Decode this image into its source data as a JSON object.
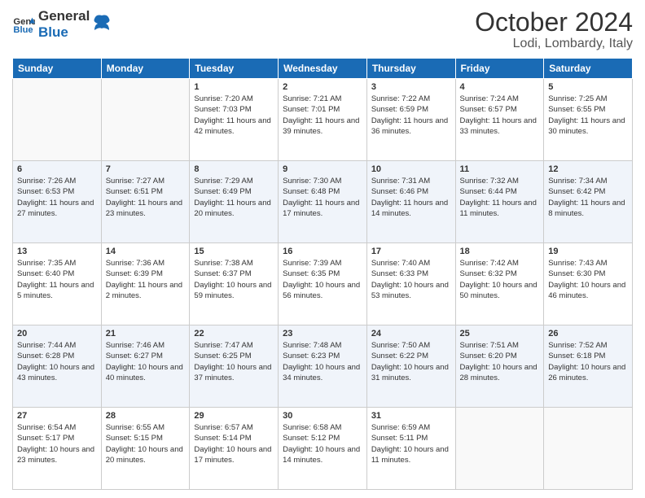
{
  "header": {
    "logo_general": "General",
    "logo_blue": "Blue",
    "month_title": "October 2024",
    "location": "Lodi, Lombardy, Italy"
  },
  "weekdays": [
    "Sunday",
    "Monday",
    "Tuesday",
    "Wednesday",
    "Thursday",
    "Friday",
    "Saturday"
  ],
  "weeks": [
    [
      {
        "day": "",
        "empty": true
      },
      {
        "day": "",
        "empty": true
      },
      {
        "day": "1",
        "sr": "7:20 AM",
        "ss": "7:03 PM",
        "dl": "11 hours and 42 minutes."
      },
      {
        "day": "2",
        "sr": "7:21 AM",
        "ss": "7:01 PM",
        "dl": "11 hours and 39 minutes."
      },
      {
        "day": "3",
        "sr": "7:22 AM",
        "ss": "6:59 PM",
        "dl": "11 hours and 36 minutes."
      },
      {
        "day": "4",
        "sr": "7:24 AM",
        "ss": "6:57 PM",
        "dl": "11 hours and 33 minutes."
      },
      {
        "day": "5",
        "sr": "7:25 AM",
        "ss": "6:55 PM",
        "dl": "11 hours and 30 minutes."
      }
    ],
    [
      {
        "day": "6",
        "sr": "7:26 AM",
        "ss": "6:53 PM",
        "dl": "11 hours and 27 minutes."
      },
      {
        "day": "7",
        "sr": "7:27 AM",
        "ss": "6:51 PM",
        "dl": "11 hours and 23 minutes."
      },
      {
        "day": "8",
        "sr": "7:29 AM",
        "ss": "6:49 PM",
        "dl": "11 hours and 20 minutes."
      },
      {
        "day": "9",
        "sr": "7:30 AM",
        "ss": "6:48 PM",
        "dl": "11 hours and 17 minutes."
      },
      {
        "day": "10",
        "sr": "7:31 AM",
        "ss": "6:46 PM",
        "dl": "11 hours and 14 minutes."
      },
      {
        "day": "11",
        "sr": "7:32 AM",
        "ss": "6:44 PM",
        "dl": "11 hours and 11 minutes."
      },
      {
        "day": "12",
        "sr": "7:34 AM",
        "ss": "6:42 PM",
        "dl": "11 hours and 8 minutes."
      }
    ],
    [
      {
        "day": "13",
        "sr": "7:35 AM",
        "ss": "6:40 PM",
        "dl": "11 hours and 5 minutes."
      },
      {
        "day": "14",
        "sr": "7:36 AM",
        "ss": "6:39 PM",
        "dl": "11 hours and 2 minutes."
      },
      {
        "day": "15",
        "sr": "7:38 AM",
        "ss": "6:37 PM",
        "dl": "10 hours and 59 minutes."
      },
      {
        "day": "16",
        "sr": "7:39 AM",
        "ss": "6:35 PM",
        "dl": "10 hours and 56 minutes."
      },
      {
        "day": "17",
        "sr": "7:40 AM",
        "ss": "6:33 PM",
        "dl": "10 hours and 53 minutes."
      },
      {
        "day": "18",
        "sr": "7:42 AM",
        "ss": "6:32 PM",
        "dl": "10 hours and 50 minutes."
      },
      {
        "day": "19",
        "sr": "7:43 AM",
        "ss": "6:30 PM",
        "dl": "10 hours and 46 minutes."
      }
    ],
    [
      {
        "day": "20",
        "sr": "7:44 AM",
        "ss": "6:28 PM",
        "dl": "10 hours and 43 minutes."
      },
      {
        "day": "21",
        "sr": "7:46 AM",
        "ss": "6:27 PM",
        "dl": "10 hours and 40 minutes."
      },
      {
        "day": "22",
        "sr": "7:47 AM",
        "ss": "6:25 PM",
        "dl": "10 hours and 37 minutes."
      },
      {
        "day": "23",
        "sr": "7:48 AM",
        "ss": "6:23 PM",
        "dl": "10 hours and 34 minutes."
      },
      {
        "day": "24",
        "sr": "7:50 AM",
        "ss": "6:22 PM",
        "dl": "10 hours and 31 minutes."
      },
      {
        "day": "25",
        "sr": "7:51 AM",
        "ss": "6:20 PM",
        "dl": "10 hours and 28 minutes."
      },
      {
        "day": "26",
        "sr": "7:52 AM",
        "ss": "6:18 PM",
        "dl": "10 hours and 26 minutes."
      }
    ],
    [
      {
        "day": "27",
        "sr": "6:54 AM",
        "ss": "5:17 PM",
        "dl": "10 hours and 23 minutes."
      },
      {
        "day": "28",
        "sr": "6:55 AM",
        "ss": "5:15 PM",
        "dl": "10 hours and 20 minutes."
      },
      {
        "day": "29",
        "sr": "6:57 AM",
        "ss": "5:14 PM",
        "dl": "10 hours and 17 minutes."
      },
      {
        "day": "30",
        "sr": "6:58 AM",
        "ss": "5:12 PM",
        "dl": "10 hours and 14 minutes."
      },
      {
        "day": "31",
        "sr": "6:59 AM",
        "ss": "5:11 PM",
        "dl": "10 hours and 11 minutes."
      },
      {
        "day": "",
        "empty": true
      },
      {
        "day": "",
        "empty": true
      }
    ]
  ],
  "labels": {
    "sunrise": "Sunrise:",
    "sunset": "Sunset:",
    "daylight": "Daylight:"
  }
}
